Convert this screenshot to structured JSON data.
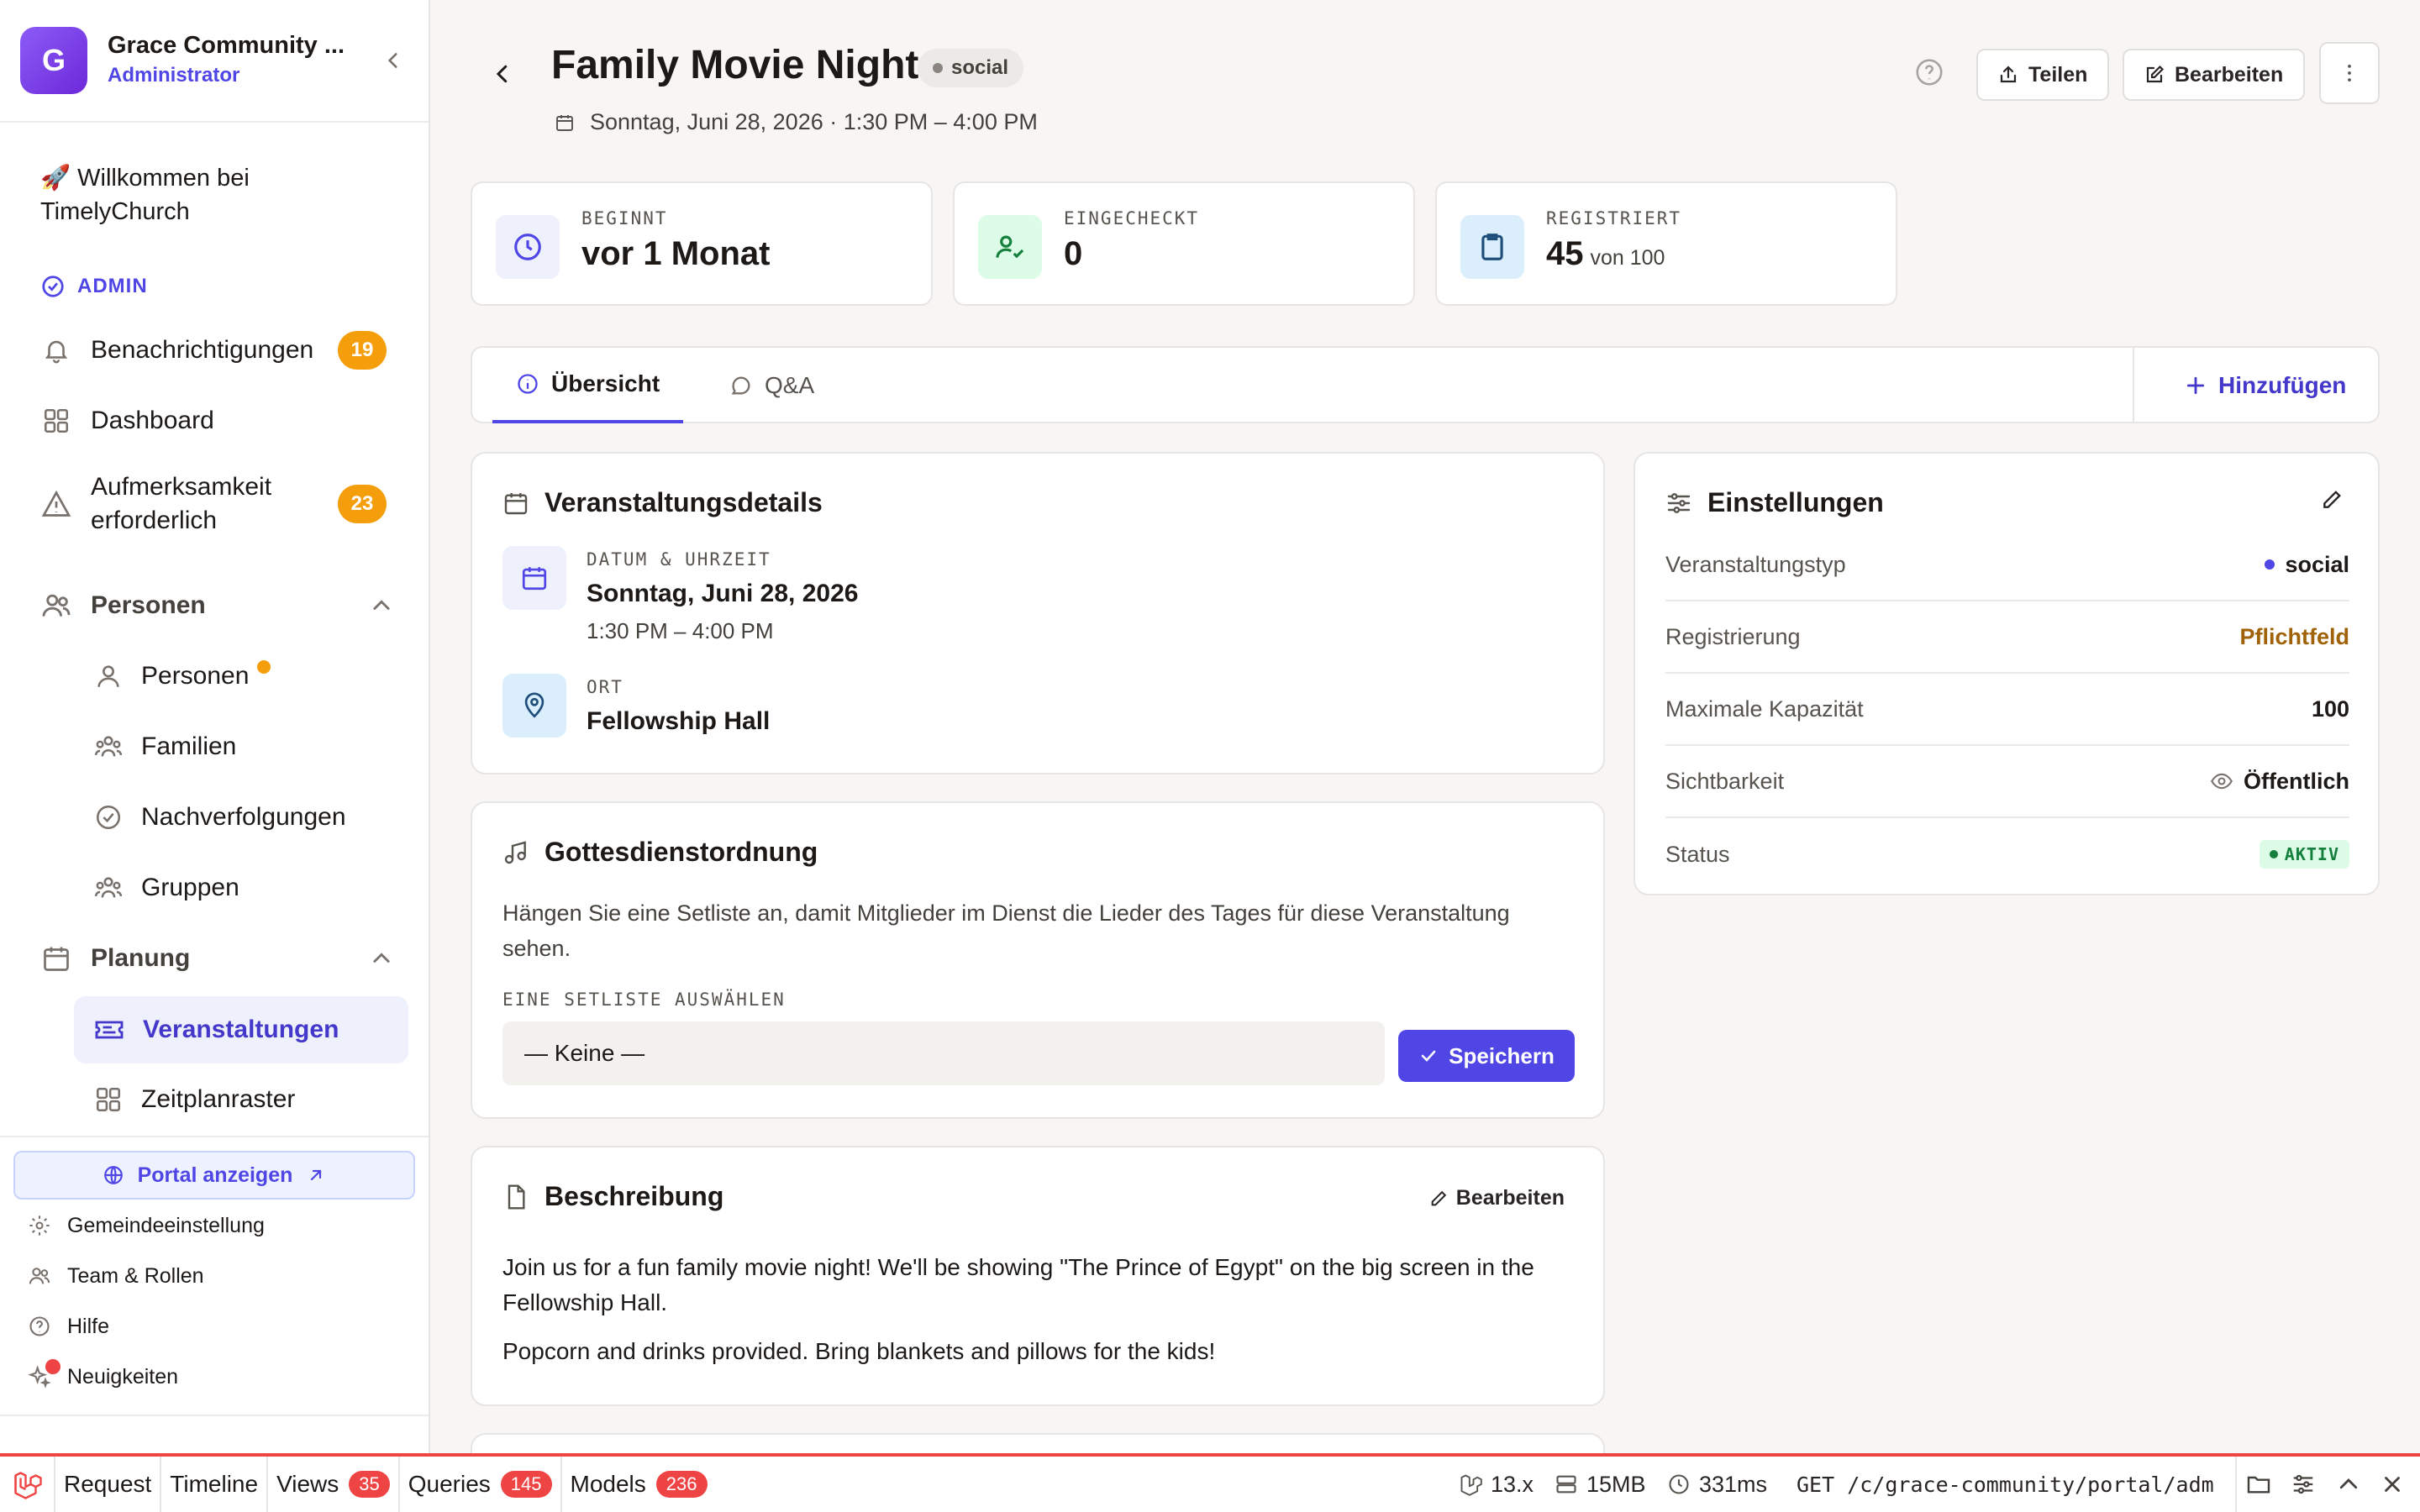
{
  "sidebar": {
    "org_initial": "G",
    "org_name": "Grace Community ...",
    "org_role": "Administrator",
    "welcome": "🚀 Willkommen bei TimelyChurch",
    "admin_label": "ADMIN",
    "notifications": {
      "label": "Benachrichtigungen",
      "count": "19"
    },
    "dashboard": "Dashboard",
    "attention": {
      "label": "Aufmerksamkeit erforderlich",
      "count": "23"
    },
    "people_section": "Personen",
    "people_items": [
      "Personen",
      "Familien",
      "Nachverfolgungen",
      "Gruppen"
    ],
    "planning_section": "Planung",
    "planning_items": [
      "Veranstaltungen",
      "Zeitplanraster"
    ],
    "portal_button": "Portal anzeigen",
    "footer": [
      "Gemeindeeinstellung",
      "Team & Rollen",
      "Hilfe",
      "Neuigkeiten"
    ]
  },
  "header": {
    "title": "Family Movie Night",
    "type_pill": "social",
    "date_line": "Sonntag, Juni 28, 2026 · 1:30 PM – 4:00 PM",
    "share_button": "Teilen",
    "edit_button": "Bearbeiten"
  },
  "stats": [
    {
      "label": "BEGINNT",
      "value": "vor 1 Monat",
      "sub": "",
      "icon": "clock-icon"
    },
    {
      "label": "EINGECHECKT",
      "value": "0",
      "sub": "",
      "icon": "user-check-icon"
    },
    {
      "label": "REGISTRIERT",
      "value": "45",
      "sub": "von 100",
      "icon": "clipboard-icon"
    }
  ],
  "tabs": [
    {
      "label": "Übersicht",
      "active": true,
      "icon": "info-icon"
    },
    {
      "label": "Q&A",
      "active": false,
      "icon": "chat-icon"
    }
  ],
  "add_button": "Hinzufügen",
  "details_card": {
    "title": "Veranstaltungsdetails",
    "datetime_label": "DATUM & UHRZEIT",
    "date": "Sonntag, Juni 28, 2026",
    "time": "1:30 PM – 4:00 PM",
    "location_label": "ORT",
    "location": "Fellowship Hall"
  },
  "service_card": {
    "title": "Gottesdienstordnung",
    "text": "Hängen Sie eine Setliste an, damit Mitglieder im Dienst die Lieder des Tages für diese Veranstaltung sehen.",
    "select_label": "EINE SETLISTE AUSWÄHLEN",
    "select_value": "— Keine —",
    "save_button": "Speichern"
  },
  "description_card": {
    "title": "Beschreibung",
    "edit_button": "Bearbeiten",
    "p1": "Join us for a fun family movie night! We'll be showing \"The Prince of Egypt\" on the big screen in the Fellowship Hall.",
    "p2": "Popcorn and drinks provided. Bring blankets and pillows for the kids!"
  },
  "settings_card": {
    "title": "Einstellungen",
    "rows": [
      {
        "key": "Veranstaltungstyp",
        "value": "social"
      },
      {
        "key": "Registrierung",
        "value": "Pflichtfeld"
      },
      {
        "key": "Maximale Kapazität",
        "value": "100"
      },
      {
        "key": "Sichtbarkeit",
        "value": "Öffentlich"
      },
      {
        "key": "Status",
        "value": "AKTIV"
      }
    ]
  },
  "debugbar": {
    "items": [
      {
        "label": "Request",
        "count": ""
      },
      {
        "label": "Timeline",
        "count": ""
      },
      {
        "label": "Views",
        "count": "35"
      },
      {
        "label": "Queries",
        "count": "145"
      },
      {
        "label": "Models",
        "count": "236"
      }
    ],
    "version": "13.x",
    "memory": "15MB",
    "duration": "331ms",
    "route": "GET /c/grace-community/portal/adm..."
  },
  "colors": {
    "accent": "#4f46e5",
    "warning": "#f59e0b",
    "danger": "#ef4444",
    "success": "#15803d",
    "required": "#a16207"
  }
}
